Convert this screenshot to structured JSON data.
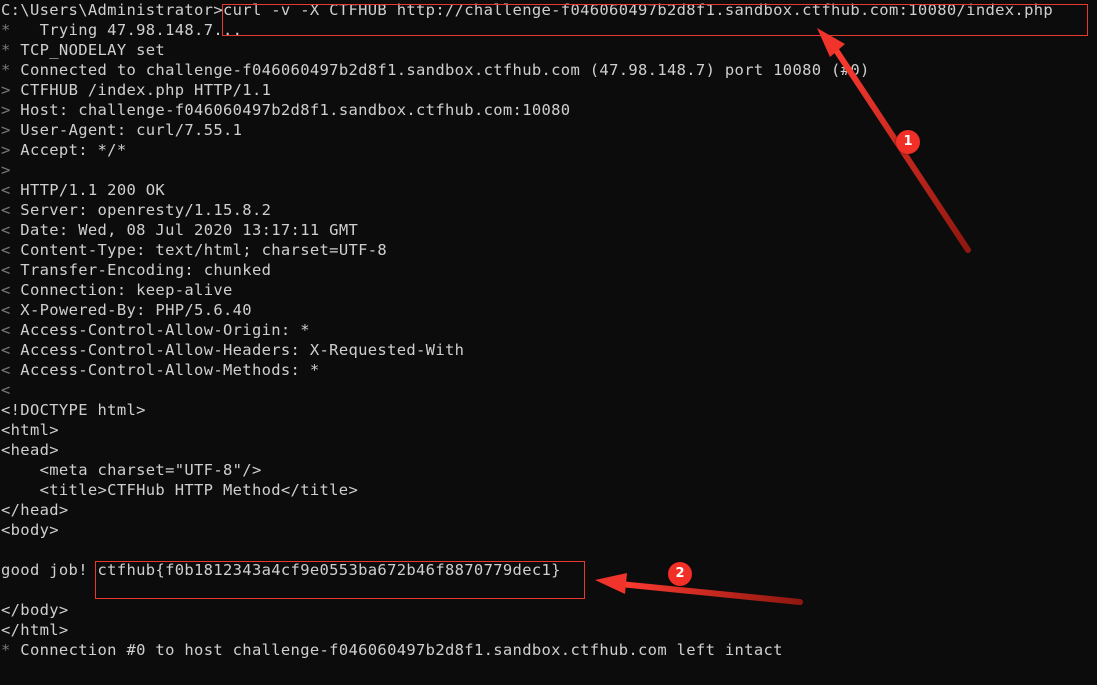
{
  "terminal": {
    "background_color": "#0c0c0c",
    "text_color": "#cccccc",
    "prefix_color": "#7a7a7a",
    "accent_color": "#e8392e",
    "lines": [
      {
        "prefix": "",
        "text": "C:\\Users\\Administrator>curl -v -X CTFHUB http://challenge-f046060497b2d8f1.sandbox.ctfhub.com:10080/index.php"
      },
      {
        "prefix": "*",
        "text": "   Trying 47.98.148.7..."
      },
      {
        "prefix": "*",
        "text": " TCP_NODELAY set"
      },
      {
        "prefix": "*",
        "text": " Connected to challenge-f046060497b2d8f1.sandbox.ctfhub.com (47.98.148.7) port 10080 (#0)"
      },
      {
        "prefix": ">",
        "text": " CTFHUB /index.php HTTP/1.1"
      },
      {
        "prefix": ">",
        "text": " Host: challenge-f046060497b2d8f1.sandbox.ctfhub.com:10080"
      },
      {
        "prefix": ">",
        "text": " User-Agent: curl/7.55.1"
      },
      {
        "prefix": ">",
        "text": " Accept: */*"
      },
      {
        "prefix": ">",
        "text": ""
      },
      {
        "prefix": "<",
        "text": " HTTP/1.1 200 OK"
      },
      {
        "prefix": "<",
        "text": " Server: openresty/1.15.8.2"
      },
      {
        "prefix": "<",
        "text": " Date: Wed, 08 Jul 2020 13:17:11 GMT"
      },
      {
        "prefix": "<",
        "text": " Content-Type: text/html; charset=UTF-8"
      },
      {
        "prefix": "<",
        "text": " Transfer-Encoding: chunked"
      },
      {
        "prefix": "<",
        "text": " Connection: keep-alive"
      },
      {
        "prefix": "<",
        "text": " X-Powered-By: PHP/5.6.40"
      },
      {
        "prefix": "<",
        "text": " Access-Control-Allow-Origin: *"
      },
      {
        "prefix": "<",
        "text": " Access-Control-Allow-Headers: X-Requested-With"
      },
      {
        "prefix": "<",
        "text": " Access-Control-Allow-Methods: *"
      },
      {
        "prefix": "<",
        "text": ""
      },
      {
        "prefix": "",
        "text": "<!DOCTYPE html>"
      },
      {
        "prefix": "",
        "text": "<html>"
      },
      {
        "prefix": "",
        "text": "<head>"
      },
      {
        "prefix": "",
        "text": "    <meta charset=\"UTF-8\"/>"
      },
      {
        "prefix": "",
        "text": "    <title>CTFHub HTTP Method</title>"
      },
      {
        "prefix": "",
        "text": "</head>"
      },
      {
        "prefix": "",
        "text": "<body>"
      },
      {
        "prefix": "",
        "text": ""
      },
      {
        "prefix": "",
        "text": "good job! ctfhub{f0b1812343a4cf9e0553ba672b46f8870779dec1}"
      },
      {
        "prefix": "",
        "text": ""
      },
      {
        "prefix": "",
        "text": "</body>"
      },
      {
        "prefix": "",
        "text": "</html>"
      },
      {
        "prefix": "*",
        "text": " Connection #0 to host challenge-f046060497b2d8f1.sandbox.ctfhub.com left intact"
      }
    ]
  },
  "annotations": {
    "command_highlight": {
      "label": "curl -v -X CTFHUB http://challenge-f046060497b2d8f1.sandbox.ctfhub.com:10080/index.php"
    },
    "flag_highlight": {
      "label": "ctfhub{f0b1812343a4cf9e0553ba672b46f8870779dec1}"
    },
    "badges": [
      {
        "number": "1"
      },
      {
        "number": "2"
      }
    ]
  }
}
